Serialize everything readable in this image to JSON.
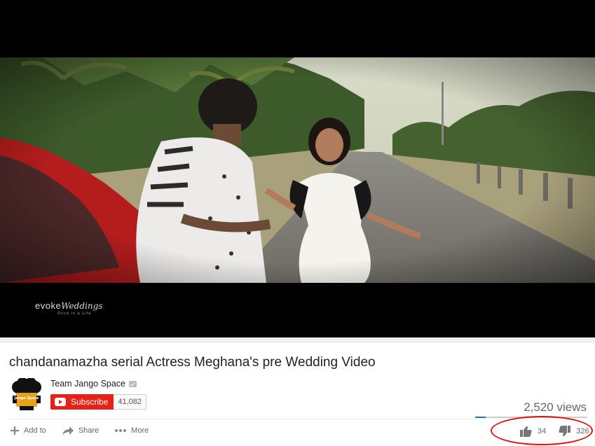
{
  "video": {
    "title": "chandanamazha serial Actress Meghana's pre Wedding Video",
    "watermark_brand": "evoke",
    "watermark_script": "Weddings",
    "watermark_tagline": "Once in a Life"
  },
  "channel": {
    "name": "Team Jango Space",
    "avatar_text": "Jango Space",
    "verified": true,
    "subscribe_label": "Subscribe",
    "subscriber_count": "41,082"
  },
  "stats": {
    "views": "2,520 views",
    "likes": "34",
    "dislikes": "326",
    "like_ratio": 0.094
  },
  "actions": {
    "add_to": "Add to",
    "share": "Share",
    "more": "More"
  },
  "annotation": {
    "color": "#e01010"
  },
  "colors": {
    "subscribe": "#e62117",
    "like_bar": "#167ac6"
  }
}
